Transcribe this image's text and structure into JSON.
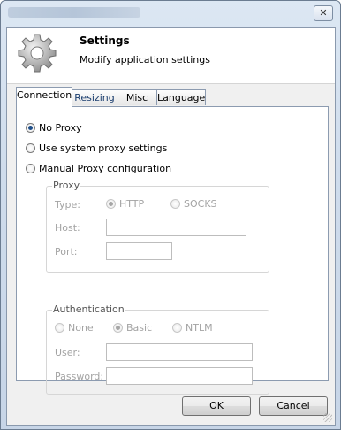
{
  "window": {
    "close_glyph": "✕"
  },
  "header": {
    "title": "Settings",
    "subtitle": "Modify application settings",
    "icon": "gear-icon"
  },
  "tabs": [
    {
      "label": "Connection",
      "active": true
    },
    {
      "label": "Resizing",
      "active": false
    },
    {
      "label": "Misc",
      "active": false
    },
    {
      "label": "Language",
      "active": false
    }
  ],
  "proxy_mode": {
    "options": [
      {
        "label": "No Proxy",
        "checked": true
      },
      {
        "label": "Use system proxy settings",
        "checked": false
      },
      {
        "label": "Manual Proxy configuration",
        "checked": false
      }
    ]
  },
  "proxy": {
    "group_label": "Proxy",
    "type_label": "Type:",
    "type_options": [
      {
        "label": "HTTP",
        "checked": true
      },
      {
        "label": "SOCKS",
        "checked": false
      }
    ],
    "host_label": "Host:",
    "host_value": "",
    "port_label": "Port:",
    "port_value": ""
  },
  "authentication": {
    "group_label": "Authentication",
    "options": [
      {
        "label": "None",
        "checked": false
      },
      {
        "label": "Basic",
        "checked": true
      },
      {
        "label": "NTLM",
        "checked": false
      }
    ],
    "user_label": "User:",
    "user_value": "",
    "password_label": "Password:",
    "password_value": ""
  },
  "buttons": {
    "ok": "OK",
    "cancel": "Cancel"
  }
}
